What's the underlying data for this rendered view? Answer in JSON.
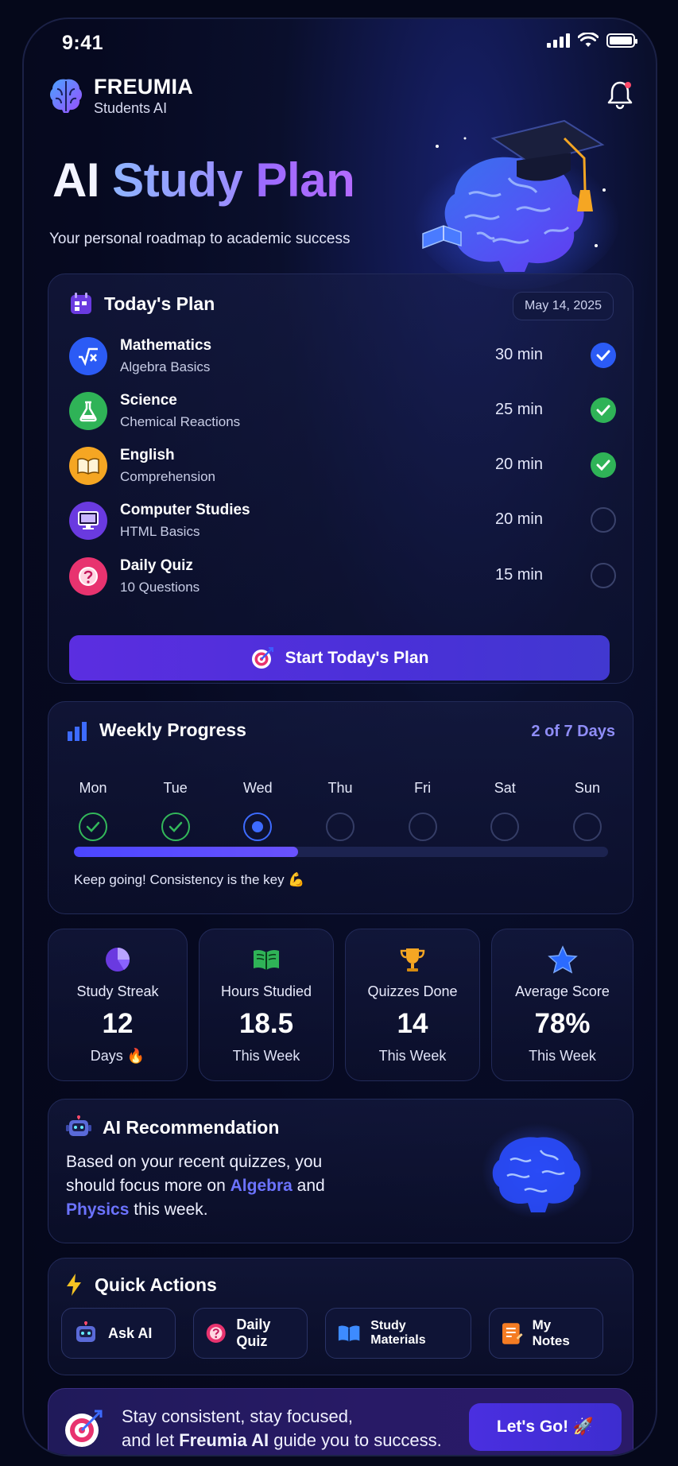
{
  "status_bar": {
    "time": "9:41"
  },
  "brand": {
    "name": "FREUMIA",
    "subtitle": "Students AI"
  },
  "hero": {
    "title_word1": "AI",
    "title_word2": "Study",
    "title_word3": "Plan",
    "subtitle": "Your personal roadmap to academic success"
  },
  "todays_plan": {
    "title": "Today's Plan",
    "date": "May 14, 2025",
    "items": [
      {
        "subject": "Mathematics",
        "topic": "Algebra Basics",
        "duration": "30 min",
        "status": "done",
        "icon": "sqrt-icon",
        "color": "#2b5bf5"
      },
      {
        "subject": "Science",
        "topic": "Chemical Reactions",
        "duration": "25 min",
        "status": "done",
        "icon": "flask-icon",
        "color": "#2fb357"
      },
      {
        "subject": "English",
        "topic": "Comprehension",
        "duration": "20 min",
        "status": "done",
        "icon": "book-icon",
        "color": "#f5a623"
      },
      {
        "subject": "Computer Studies",
        "topic": "HTML Basics",
        "duration": "20 min",
        "status": "pending",
        "icon": "monitor-icon",
        "color": "#6a3ae0"
      },
      {
        "subject": "Daily Quiz",
        "topic": "10 Questions",
        "duration": "15 min",
        "status": "pending",
        "icon": "question-icon",
        "color": "#e8336f"
      }
    ],
    "start_button": "Start Today's Plan"
  },
  "weekly_progress": {
    "title": "Weekly Progress",
    "summary": "2 of 7 Days",
    "days": [
      {
        "label": "Mon",
        "state": "done"
      },
      {
        "label": "Tue",
        "state": "done"
      },
      {
        "label": "Wed",
        "state": "current"
      },
      {
        "label": "Thu",
        "state": "pending"
      },
      {
        "label": "Fri",
        "state": "pending"
      },
      {
        "label": "Sat",
        "state": "pending"
      },
      {
        "label": "Sun",
        "state": "pending"
      }
    ],
    "progress_fraction": 0.42,
    "message": "Keep going! Consistency is the key 💪"
  },
  "stats": [
    {
      "label": "Study Streak",
      "value": "12",
      "sub": "Days 🔥",
      "icon": "pie-chart-icon"
    },
    {
      "label": "Hours Studied",
      "value": "18.5",
      "sub": "This Week",
      "icon": "open-book-icon"
    },
    {
      "label": "Quizzes Done",
      "value": "14",
      "sub": "This Week",
      "icon": "trophy-icon"
    },
    {
      "label": "Average Score",
      "value": "78%",
      "sub": "This Week",
      "icon": "star-icon"
    }
  ],
  "recommendation": {
    "title": "AI Recommendation",
    "text_part1": "Based on your recent quizzes, you should focus more on",
    "highlight1": "Algebra",
    "text_part2": "and",
    "highlight2": "Physics",
    "text_part3": "this week."
  },
  "quick_actions": {
    "title": "Quick Actions",
    "items": [
      {
        "label": "Ask AI",
        "icon": "robot-icon"
      },
      {
        "label": "Daily Quiz",
        "icon": "quiz-icon"
      },
      {
        "label": "Study Materials",
        "icon": "book-icon"
      },
      {
        "label": "My Notes",
        "icon": "notes-icon"
      }
    ]
  },
  "cta": {
    "line1": "Stay consistent, stay focused,",
    "line2_pre": "and let",
    "line2_bold": "Freumia AI",
    "line2_post": "guide you to success.",
    "button": "Let's Go! 🚀"
  },
  "colors": {
    "accent": "#5b2ee0",
    "blue": "#2b5bf5",
    "green": "#2fb357",
    "highlight": "#6c73ff"
  }
}
